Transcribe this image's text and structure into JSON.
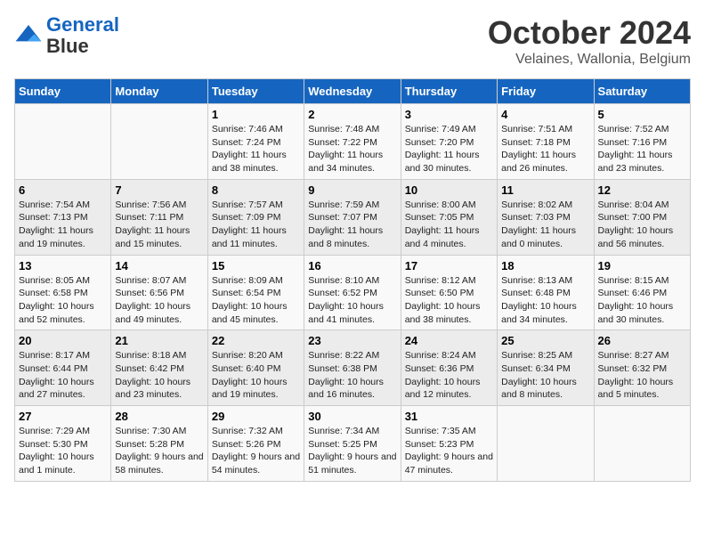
{
  "logo": {
    "line1": "General",
    "line2": "Blue"
  },
  "title": "October 2024",
  "location": "Velaines, Wallonia, Belgium",
  "headers": [
    "Sunday",
    "Monday",
    "Tuesday",
    "Wednesday",
    "Thursday",
    "Friday",
    "Saturday"
  ],
  "weeks": [
    [
      {
        "day": "",
        "sunrise": "",
        "sunset": "",
        "daylight": ""
      },
      {
        "day": "",
        "sunrise": "",
        "sunset": "",
        "daylight": ""
      },
      {
        "day": "1",
        "sunrise": "Sunrise: 7:46 AM",
        "sunset": "Sunset: 7:24 PM",
        "daylight": "Daylight: 11 hours and 38 minutes."
      },
      {
        "day": "2",
        "sunrise": "Sunrise: 7:48 AM",
        "sunset": "Sunset: 7:22 PM",
        "daylight": "Daylight: 11 hours and 34 minutes."
      },
      {
        "day": "3",
        "sunrise": "Sunrise: 7:49 AM",
        "sunset": "Sunset: 7:20 PM",
        "daylight": "Daylight: 11 hours and 30 minutes."
      },
      {
        "day": "4",
        "sunrise": "Sunrise: 7:51 AM",
        "sunset": "Sunset: 7:18 PM",
        "daylight": "Daylight: 11 hours and 26 minutes."
      },
      {
        "day": "5",
        "sunrise": "Sunrise: 7:52 AM",
        "sunset": "Sunset: 7:16 PM",
        "daylight": "Daylight: 11 hours and 23 minutes."
      }
    ],
    [
      {
        "day": "6",
        "sunrise": "Sunrise: 7:54 AM",
        "sunset": "Sunset: 7:13 PM",
        "daylight": "Daylight: 11 hours and 19 minutes."
      },
      {
        "day": "7",
        "sunrise": "Sunrise: 7:56 AM",
        "sunset": "Sunset: 7:11 PM",
        "daylight": "Daylight: 11 hours and 15 minutes."
      },
      {
        "day": "8",
        "sunrise": "Sunrise: 7:57 AM",
        "sunset": "Sunset: 7:09 PM",
        "daylight": "Daylight: 11 hours and 11 minutes."
      },
      {
        "day": "9",
        "sunrise": "Sunrise: 7:59 AM",
        "sunset": "Sunset: 7:07 PM",
        "daylight": "Daylight: 11 hours and 8 minutes."
      },
      {
        "day": "10",
        "sunrise": "Sunrise: 8:00 AM",
        "sunset": "Sunset: 7:05 PM",
        "daylight": "Daylight: 11 hours and 4 minutes."
      },
      {
        "day": "11",
        "sunrise": "Sunrise: 8:02 AM",
        "sunset": "Sunset: 7:03 PM",
        "daylight": "Daylight: 11 hours and 0 minutes."
      },
      {
        "day": "12",
        "sunrise": "Sunrise: 8:04 AM",
        "sunset": "Sunset: 7:00 PM",
        "daylight": "Daylight: 10 hours and 56 minutes."
      }
    ],
    [
      {
        "day": "13",
        "sunrise": "Sunrise: 8:05 AM",
        "sunset": "Sunset: 6:58 PM",
        "daylight": "Daylight: 10 hours and 52 minutes."
      },
      {
        "day": "14",
        "sunrise": "Sunrise: 8:07 AM",
        "sunset": "Sunset: 6:56 PM",
        "daylight": "Daylight: 10 hours and 49 minutes."
      },
      {
        "day": "15",
        "sunrise": "Sunrise: 8:09 AM",
        "sunset": "Sunset: 6:54 PM",
        "daylight": "Daylight: 10 hours and 45 minutes."
      },
      {
        "day": "16",
        "sunrise": "Sunrise: 8:10 AM",
        "sunset": "Sunset: 6:52 PM",
        "daylight": "Daylight: 10 hours and 41 minutes."
      },
      {
        "day": "17",
        "sunrise": "Sunrise: 8:12 AM",
        "sunset": "Sunset: 6:50 PM",
        "daylight": "Daylight: 10 hours and 38 minutes."
      },
      {
        "day": "18",
        "sunrise": "Sunrise: 8:13 AM",
        "sunset": "Sunset: 6:48 PM",
        "daylight": "Daylight: 10 hours and 34 minutes."
      },
      {
        "day": "19",
        "sunrise": "Sunrise: 8:15 AM",
        "sunset": "Sunset: 6:46 PM",
        "daylight": "Daylight: 10 hours and 30 minutes."
      }
    ],
    [
      {
        "day": "20",
        "sunrise": "Sunrise: 8:17 AM",
        "sunset": "Sunset: 6:44 PM",
        "daylight": "Daylight: 10 hours and 27 minutes."
      },
      {
        "day": "21",
        "sunrise": "Sunrise: 8:18 AM",
        "sunset": "Sunset: 6:42 PM",
        "daylight": "Daylight: 10 hours and 23 minutes."
      },
      {
        "day": "22",
        "sunrise": "Sunrise: 8:20 AM",
        "sunset": "Sunset: 6:40 PM",
        "daylight": "Daylight: 10 hours and 19 minutes."
      },
      {
        "day": "23",
        "sunrise": "Sunrise: 8:22 AM",
        "sunset": "Sunset: 6:38 PM",
        "daylight": "Daylight: 10 hours and 16 minutes."
      },
      {
        "day": "24",
        "sunrise": "Sunrise: 8:24 AM",
        "sunset": "Sunset: 6:36 PM",
        "daylight": "Daylight: 10 hours and 12 minutes."
      },
      {
        "day": "25",
        "sunrise": "Sunrise: 8:25 AM",
        "sunset": "Sunset: 6:34 PM",
        "daylight": "Daylight: 10 hours and 8 minutes."
      },
      {
        "day": "26",
        "sunrise": "Sunrise: 8:27 AM",
        "sunset": "Sunset: 6:32 PM",
        "daylight": "Daylight: 10 hours and 5 minutes."
      }
    ],
    [
      {
        "day": "27",
        "sunrise": "Sunrise: 7:29 AM",
        "sunset": "Sunset: 5:30 PM",
        "daylight": "Daylight: 10 hours and 1 minute."
      },
      {
        "day": "28",
        "sunrise": "Sunrise: 7:30 AM",
        "sunset": "Sunset: 5:28 PM",
        "daylight": "Daylight: 9 hours and 58 minutes."
      },
      {
        "day": "29",
        "sunrise": "Sunrise: 7:32 AM",
        "sunset": "Sunset: 5:26 PM",
        "daylight": "Daylight: 9 hours and 54 minutes."
      },
      {
        "day": "30",
        "sunrise": "Sunrise: 7:34 AM",
        "sunset": "Sunset: 5:25 PM",
        "daylight": "Daylight: 9 hours and 51 minutes."
      },
      {
        "day": "31",
        "sunrise": "Sunrise: 7:35 AM",
        "sunset": "Sunset: 5:23 PM",
        "daylight": "Daylight: 9 hours and 47 minutes."
      },
      {
        "day": "",
        "sunrise": "",
        "sunset": "",
        "daylight": ""
      },
      {
        "day": "",
        "sunrise": "",
        "sunset": "",
        "daylight": ""
      }
    ]
  ]
}
